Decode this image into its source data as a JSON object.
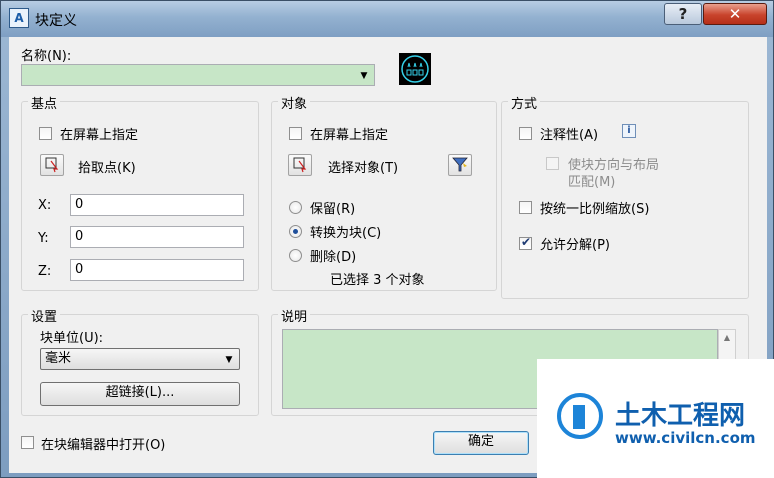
{
  "window": {
    "title": "块定义",
    "app_icon_text": "A",
    "help_label": "?",
    "close_label": "✕"
  },
  "name": {
    "label": "名称(N):",
    "value": ""
  },
  "basepoint": {
    "title": "基点",
    "specify_on_screen": "在屏幕上指定",
    "pick_point": "拾取点(K)",
    "x_label": "X:",
    "y_label": "Y:",
    "z_label": "Z:",
    "x_value": "0",
    "y_value": "0",
    "z_value": "0"
  },
  "objects": {
    "title": "对象",
    "specify_on_screen": "在屏幕上指定",
    "select_objects": "选择对象(T)",
    "retain": "保留(R)",
    "convert_to_block": "转换为块(C)",
    "delete": "删除(D)",
    "selected_status": "已选择 3 个对象"
  },
  "behavior": {
    "title": "方式",
    "annotative": "注释性(A)",
    "info_icon": "i",
    "match_orientation_line1": "使块方向与布局",
    "match_orientation_line2": "匹配(M)",
    "scale_uniformly": "按统一比例缩放(S)",
    "allow_exploding": "允许分解(P)"
  },
  "settings": {
    "title": "设置",
    "block_unit_label": "块单位(U):",
    "block_unit_value": "毫米",
    "hyperlink_button": "超链接(L)..."
  },
  "description": {
    "title": "说明",
    "value": ""
  },
  "footer": {
    "open_in_editor": "在块编辑器中打开(O)",
    "ok_button": "确定"
  },
  "watermark": {
    "name": "土木工程网",
    "url": "www.civilcn.com"
  }
}
